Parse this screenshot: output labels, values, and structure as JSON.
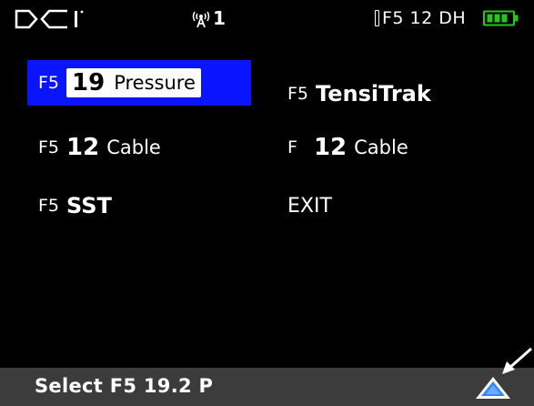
{
  "status_bar": {
    "logo_text": "DCI",
    "logo_icon": "dci-logo",
    "signal_icon": "antenna-signal-icon",
    "signal_channel": "1",
    "tool_info": "F5 12 DH",
    "battery_icon": "battery-icon",
    "battery_color": "#22c81e"
  },
  "menu": {
    "items": [
      {
        "prefix": "F5",
        "number": "19",
        "label": "Pressure",
        "selected": true
      },
      {
        "prefix": "F5",
        "number": "",
        "label": "TensiTrak",
        "selected": false
      },
      {
        "prefix": "F5",
        "number": "12",
        "label": "Cable",
        "selected": false
      },
      {
        "prefix": "F",
        "number": "12",
        "label": "Cable",
        "selected": false
      },
      {
        "prefix": "F5",
        "number": "",
        "label": "SST",
        "selected": false
      },
      {
        "prefix": "",
        "number": "",
        "label": "EXIT",
        "selected": false
      }
    ]
  },
  "bottom_bar": {
    "text": "Select F5 19.2 P",
    "up_button_icon": "up-triangle-icon",
    "pointer_icon": "arrow-pointer-icon"
  },
  "colors": {
    "background": "#000000",
    "selection": "#0a14ff",
    "bottom_bar": "#3c3c3c",
    "up_arrow": "#2f87ff"
  }
}
